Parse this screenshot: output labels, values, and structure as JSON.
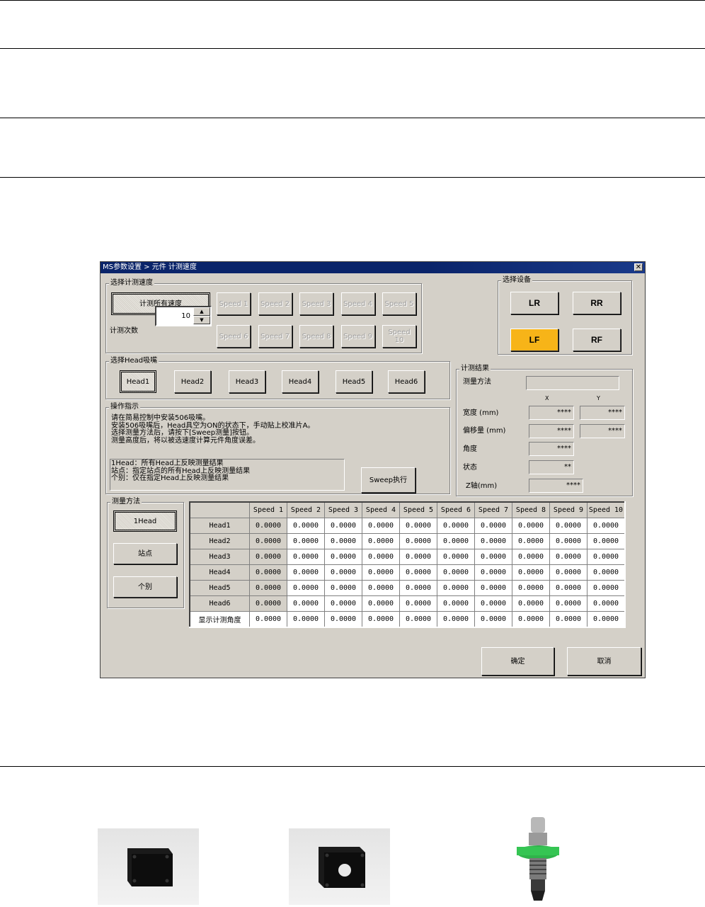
{
  "window": {
    "title": "MS参数设置 > 元件 计测速度",
    "close_glyph": "✕"
  },
  "speed_group": {
    "title": "选择计测速度",
    "all_speed_label": "计测所有速度",
    "speeds": [
      "Speed 1",
      "Speed 2",
      "Speed 3",
      "Speed 4",
      "Speed 5",
      "Speed 6",
      "Speed 7",
      "Speed 8",
      "Speed 9",
      "Speed 10"
    ],
    "count_label": "计测次数",
    "count_value": "10",
    "spin_up": "▲",
    "spin_down": "▼"
  },
  "device_group": {
    "title": "选择设备",
    "buttons": [
      "LR",
      "RR",
      "LF",
      "RF"
    ],
    "selected": "LF",
    "selected_color": "#f7b418"
  },
  "head_group": {
    "title": "选择Head吸嘴",
    "heads": [
      "Head1",
      "Head2",
      "Head3",
      "Head4",
      "Head5",
      "Head6"
    ],
    "selected": "Head1"
  },
  "instructions": {
    "title": "操作指示",
    "lines": [
      "请在简易控制中安装506吸嘴。",
      "安装506吸嘴后，Head具空为ON的状态下，手动贴上校准片A。",
      "选择测量方法后，请按下[Sweep测量]按钮。",
      "测量高度后，将以被选速度计算元件角度误差。"
    ],
    "notes": [
      "1Head：所有Head上反映测量结果",
      "站点：指定站点的所有Head上反映测量结果",
      "个别：仅在指定Head上反映测量结果"
    ],
    "sweep_label": "Sweep执行"
  },
  "results": {
    "title": "计测结果",
    "method_label": "测量方法",
    "method_value": "",
    "col_x": "X",
    "col_y": "Y",
    "width_label": "宽度 (mm)",
    "width_x": "****",
    "width_y": "****",
    "offset_label": "偏移量 (mm)",
    "offset_x": "****",
    "offset_y": "****",
    "angle_label": "角度",
    "angle_value": "****",
    "status_label": "状态",
    "status_value": "**",
    "z_label": "Z轴(mm)",
    "z_value": "****"
  },
  "method_group": {
    "title": "测量方法",
    "options": [
      "1Head",
      "站点",
      "个别"
    ],
    "selected": "1Head"
  },
  "table": {
    "columns": [
      "Speed 1",
      "Speed 2",
      "Speed 3",
      "Speed 4",
      "Speed 5",
      "Speed 6",
      "Speed 7",
      "Speed 8",
      "Speed 9",
      "Speed 10"
    ],
    "rows": [
      {
        "label": "Head1",
        "values": [
          "0.0000",
          "0.0000",
          "0.0000",
          "0.0000",
          "0.0000",
          "0.0000",
          "0.0000",
          "0.0000",
          "0.0000",
          "0.0000"
        ]
      },
      {
        "label": "Head2",
        "values": [
          "0.0000",
          "0.0000",
          "0.0000",
          "0.0000",
          "0.0000",
          "0.0000",
          "0.0000",
          "0.0000",
          "0.0000",
          "0.0000"
        ]
      },
      {
        "label": "Head3",
        "values": [
          "0.0000",
          "0.0000",
          "0.0000",
          "0.0000",
          "0.0000",
          "0.0000",
          "0.0000",
          "0.0000",
          "0.0000",
          "0.0000"
        ]
      },
      {
        "label": "Head4",
        "values": [
          "0.0000",
          "0.0000",
          "0.0000",
          "0.0000",
          "0.0000",
          "0.0000",
          "0.0000",
          "0.0000",
          "0.0000",
          "0.0000"
        ]
      },
      {
        "label": "Head5",
        "values": [
          "0.0000",
          "0.0000",
          "0.0000",
          "0.0000",
          "0.0000",
          "0.0000",
          "0.0000",
          "0.0000",
          "0.0000",
          "0.0000"
        ]
      },
      {
        "label": "Head6",
        "values": [
          "0.0000",
          "0.0000",
          "0.0000",
          "0.0000",
          "0.0000",
          "0.0000",
          "0.0000",
          "0.0000",
          "0.0000",
          "0.0000"
        ]
      },
      {
        "label": "显示计测角度",
        "values": [
          "0.0000",
          "0.0000",
          "0.0000",
          "0.0000",
          "0.0000",
          "0.0000",
          "0.0000",
          "0.0000",
          "0.0000",
          "0.0000"
        ]
      }
    ]
  },
  "footer": {
    "ok_label": "确定",
    "cancel_label": "取消"
  }
}
